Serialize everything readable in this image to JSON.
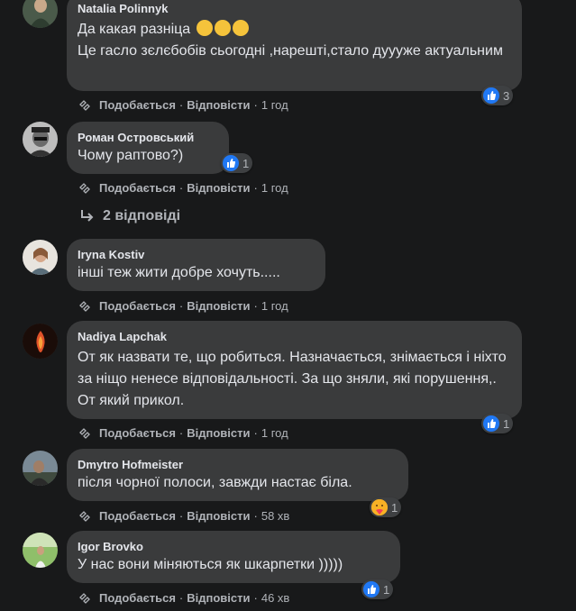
{
  "comments": [
    {
      "author": "Natalia Polinnyk",
      "text": "Да какая разніца 😂😂😂\nЦе гасло зєлєбобів сьогодні ,нарешті,стало дуууже актуальним",
      "like": "Подобається",
      "reply": "Відповісти",
      "time": "1 год",
      "reaction_count": "3"
    },
    {
      "author": "Роман Островський",
      "text": "Чому раптово?)",
      "like": "Подобається",
      "reply": "Відповісти",
      "time": "1 год",
      "reaction_count": "1"
    },
    {
      "author": "Iryna Kostiv",
      "text": "інші теж жити добре хочуть.....",
      "like": "Подобається",
      "reply": "Відповісти",
      "time": "1 год"
    },
    {
      "author": "Nadiya Lapchak",
      "text": "От як назвати те, що робиться. Назначається, знімається і ніхто за ніщо ненесе відповідальності. За що зняли, які порушення,. От який прикол.",
      "like": "Подобається",
      "reply": "Відповісти",
      "time": "1 год",
      "reaction_count": "1"
    },
    {
      "author": "Dmytro Hofmeister",
      "text": "після чорної полоси, завжди настає біла.",
      "like": "Подобається",
      "reply": "Відповісти",
      "time": "58 хв",
      "reaction_count": "1"
    },
    {
      "author": "Igor Brovko",
      "text": "У нас вони міняються як шкарпетки )))))",
      "like": "Подобається",
      "reply": "Відповісти",
      "time": "46 хв",
      "reaction_count": "1"
    }
  ],
  "replies_link": "2 відповіді",
  "separator": "·",
  "colors": {
    "background": "#18191a",
    "bubble": "#3a3b3c",
    "like_blue": "#2078f4",
    "secondary_text": "#b0b3b8"
  }
}
